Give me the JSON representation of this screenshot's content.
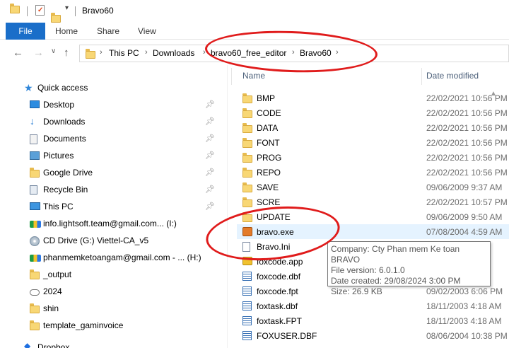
{
  "window": {
    "title": "Bravo60"
  },
  "ribbon": {
    "tabs": [
      "File",
      "Home",
      "Share",
      "View"
    ]
  },
  "address": {
    "crumbs": [
      "This PC",
      "Downloads",
      "bravo60_free_editor",
      "Bravo60"
    ]
  },
  "nav": {
    "items": [
      {
        "label": "Quick access",
        "icon": "star-icon",
        "pinned": false
      },
      {
        "label": "Desktop",
        "icon": "desktop-icon",
        "pinned": true
      },
      {
        "label": "Downloads",
        "icon": "download-icon",
        "pinned": true
      },
      {
        "label": "Documents",
        "icon": "documents-icon",
        "pinned": true
      },
      {
        "label": "Pictures",
        "icon": "pictures-icon",
        "pinned": true
      },
      {
        "label": "Google Drive",
        "icon": "folder-icon",
        "pinned": true
      },
      {
        "label": "Recycle Bin",
        "icon": "recycle-bin-icon",
        "pinned": true
      },
      {
        "label": "This PC",
        "icon": "pc-icon",
        "pinned": true
      },
      {
        "label": "info.lightsoft.team@gmail.com... (I:)",
        "icon": "google-drive-icon",
        "pinned": false
      },
      {
        "label": "CD Drive (G:) Viettel-CA_v5",
        "icon": "cd-drive-icon",
        "pinned": false
      },
      {
        "label": "phanmemketoangam@gmail.com - ... (H:)",
        "icon": "google-drive-icon",
        "pinned": false
      },
      {
        "label": "_output",
        "icon": "folder-icon",
        "pinned": false
      },
      {
        "label": "2024",
        "icon": "cloud-folder-icon",
        "pinned": false
      },
      {
        "label": "shin",
        "icon": "folder-icon",
        "pinned": false
      },
      {
        "label": "template_gaminvoice",
        "icon": "folder-icon",
        "pinned": false
      },
      {
        "label": "Dropbox",
        "icon": "dropbox-icon",
        "pinned": false
      }
    ]
  },
  "list": {
    "headers": {
      "name": "Name",
      "date": "Date modified"
    },
    "rows": [
      {
        "name": "BMP",
        "date": "22/02/2021 10:56 PM",
        "icon": "folder-icon"
      },
      {
        "name": "CODE",
        "date": "22/02/2021 10:56 PM",
        "icon": "folder-icon"
      },
      {
        "name": "DATA",
        "date": "22/02/2021 10:56 PM",
        "icon": "folder-icon"
      },
      {
        "name": "FONT",
        "date": "22/02/2021 10:56 PM",
        "icon": "folder-icon"
      },
      {
        "name": "PROG",
        "date": "22/02/2021 10:56 PM",
        "icon": "folder-icon"
      },
      {
        "name": "REPO",
        "date": "22/02/2021 10:56 PM",
        "icon": "folder-icon"
      },
      {
        "name": "SAVE",
        "date": "09/06/2009 9:37 AM",
        "icon": "folder-icon"
      },
      {
        "name": "SCRE",
        "date": "22/02/2021 10:57 PM",
        "icon": "folder-icon"
      },
      {
        "name": "UPDATE",
        "date": "09/06/2009 9:50 AM",
        "icon": "folder-icon"
      },
      {
        "name": "bravo.exe",
        "date": "07/08/2004 4:59 AM",
        "icon": "exe-icon"
      },
      {
        "name": "Bravo.Ini",
        "date": "",
        "icon": "ini-file-icon"
      },
      {
        "name": "foxcode.app",
        "date": "",
        "icon": "app-file-icon"
      },
      {
        "name": "foxcode.dbf",
        "date": "",
        "icon": "dbf-file-icon"
      },
      {
        "name": "foxcode.fpt",
        "date": "09/02/2003 6:06 PM",
        "icon": "dbf-file-icon"
      },
      {
        "name": "foxtask.dbf",
        "date": "18/11/2003 4:18 AM",
        "icon": "dbf-file-icon"
      },
      {
        "name": "foxtask.FPT",
        "date": "18/11/2003 4:18 AM",
        "icon": "dbf-file-icon"
      },
      {
        "name": "FOXUSER.DBF",
        "date": "08/06/2004 10:38 PM",
        "icon": "dbf-file-icon"
      }
    ]
  },
  "tooltip": {
    "lines": [
      "Company: Cty Phan mem Ke toan BRAVO",
      "File version: 6.0.1.0",
      "Date created: 29/08/2024 3:00 PM",
      "Size: 26.9 KB"
    ]
  }
}
